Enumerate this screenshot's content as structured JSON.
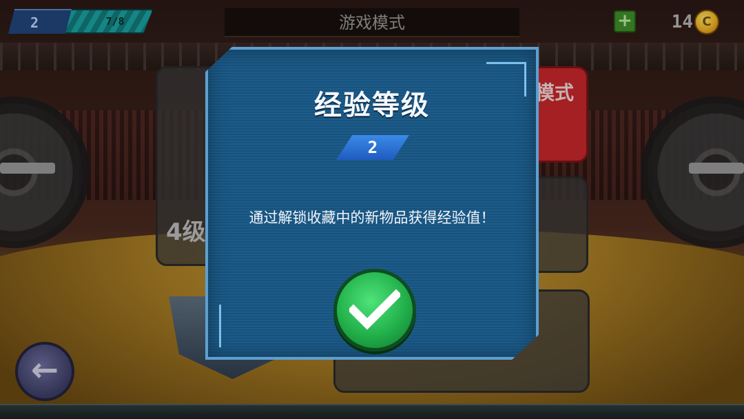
{
  "hud": {
    "player_level": "2",
    "xp_progress": "7/8",
    "mode_title": "游戏模式",
    "coins": "14",
    "coin_symbol": "C"
  },
  "background_cards": {
    "left_level_text": "4级",
    "right_mode_text": "模式"
  },
  "dialog": {
    "title": "经验等级",
    "level_badge": "2",
    "message": "通过解锁收藏中的新物品获得经验值！",
    "confirm_icon": "checkmark-icon"
  },
  "colors": {
    "dialog_bg": "#1d5c8a",
    "dialog_border": "#5ea0d0",
    "confirm_green": "#22b04a",
    "xp_bar": "#1aa3a3",
    "coin_gold": "#f0b020"
  }
}
